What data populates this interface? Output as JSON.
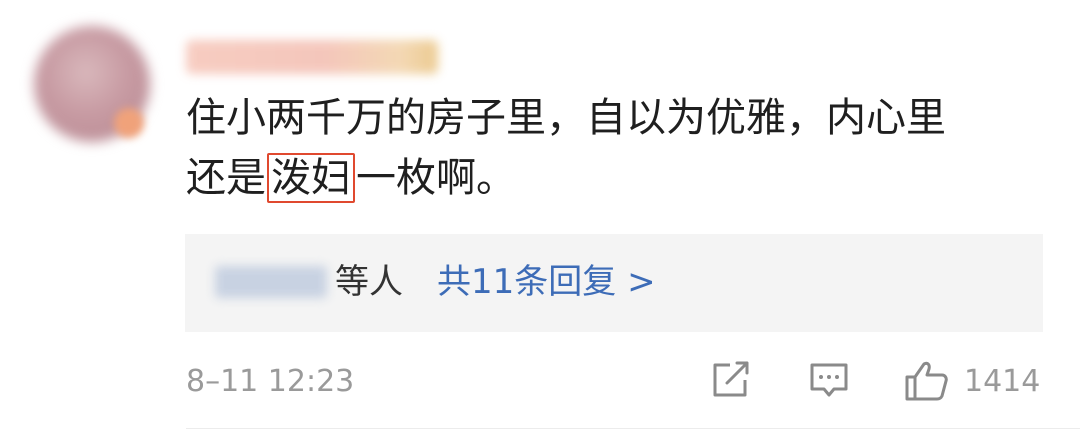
{
  "comment": {
    "text_line1": "住小两千万的房子里，自以为优雅，内心里",
    "text_line2_pre": "还是",
    "text_line2_highlight": "泼妇",
    "text_line2_post": "一枚啊。",
    "highlight_color": "#e0492f"
  },
  "replies": {
    "suffix": "等人",
    "link_label": "共11条回复 >",
    "link_color": "#3d6cb7"
  },
  "footer": {
    "timestamp": "8–11 12:23",
    "like_count": "1414",
    "icons": [
      "share-icon",
      "comment-icon",
      "like-icon"
    ]
  }
}
